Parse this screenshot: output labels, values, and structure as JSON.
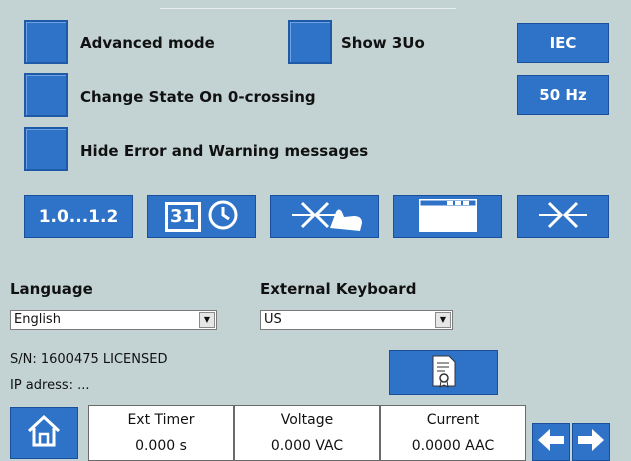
{
  "toggles": {
    "advanced_mode": "Advanced mode",
    "show_3uo": "Show 3Uo",
    "change_state": "Change State On 0-crossing",
    "hide_messages": "Hide Error and Warning messages"
  },
  "buttons": {
    "standard": "IEC",
    "frequency": "50 Hz"
  },
  "toolbar": {
    "ratio_label": "1.0...1.2",
    "calendar_day": "31"
  },
  "settings": {
    "language_label": "Language",
    "language_value": "English",
    "keyboard_label": "External Keyboard",
    "keyboard_value": "US"
  },
  "device": {
    "serial": "S/N: 1600475  LICENSED",
    "ip": "IP adress: ..."
  },
  "status_bar": {
    "ext_timer_label": "Ext Timer",
    "ext_timer_value": "0.000 s",
    "voltage_label": "Voltage",
    "voltage_value": "0.000 VAC",
    "current_label": "Current",
    "current_value": "0.0000 AAC"
  },
  "colors": {
    "background": "#c3d3d4",
    "button_blue": "#2f73c8"
  },
  "icons": [
    "home-icon",
    "calendar-icon",
    "clock-icon",
    "breaker-touch-icon",
    "window-icon",
    "breaker-icon",
    "certificate-icon",
    "arrow-left-icon",
    "arrow-right-icon"
  ]
}
